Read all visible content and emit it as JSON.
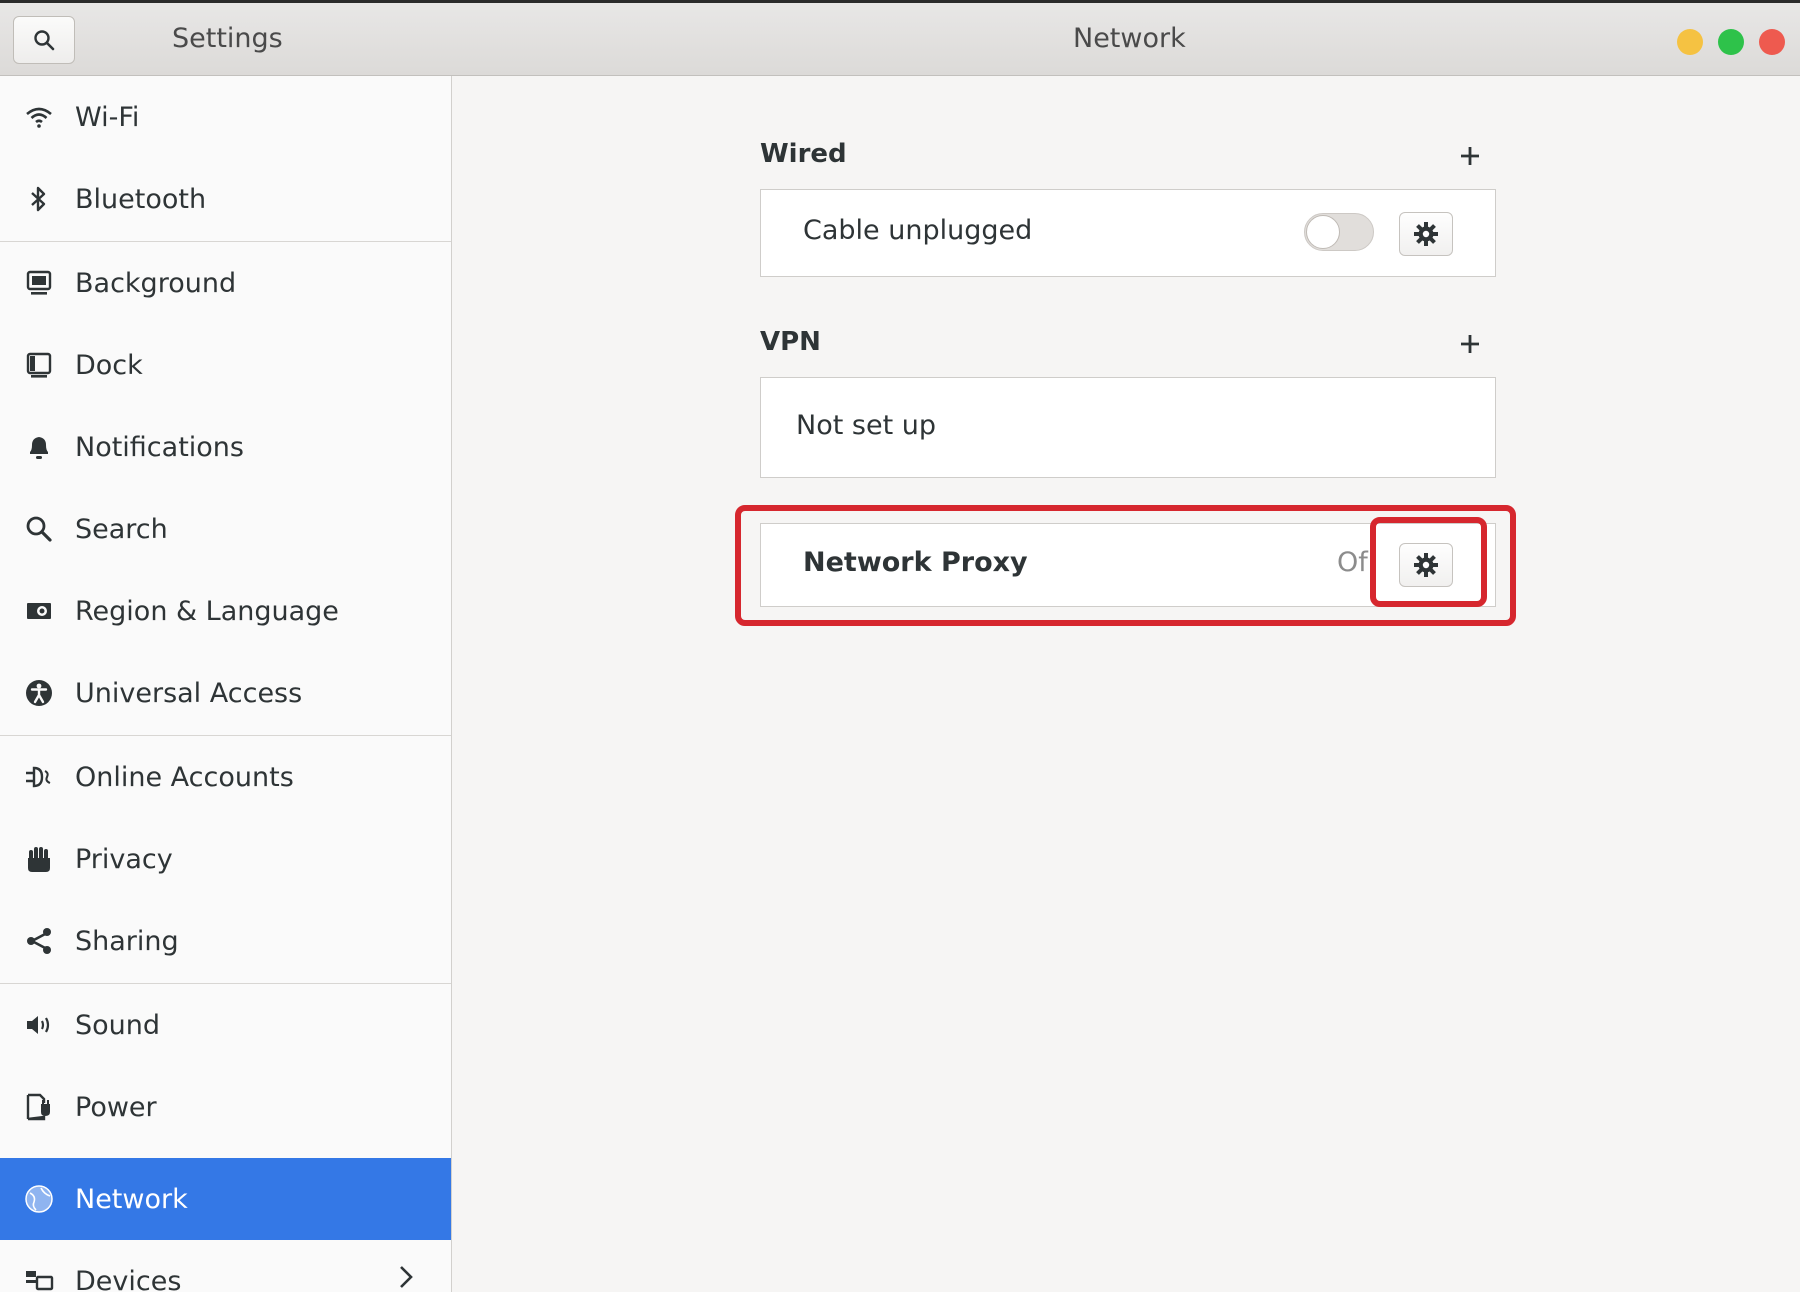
{
  "header": {
    "app_title": "Settings",
    "page_title": "Network",
    "search_icon": "search-icon",
    "window_controls": {
      "minimize_color": "#f5c242",
      "maximize_color": "#2ec24a",
      "close_color": "#ee5a4f"
    }
  },
  "sidebar": {
    "items": [
      {
        "label": "Wi-Fi",
        "icon": "wifi-icon"
      },
      {
        "label": "Bluetooth",
        "icon": "bluetooth-icon"
      },
      {
        "label": "Background",
        "icon": "background-icon"
      },
      {
        "label": "Dock",
        "icon": "dock-icon"
      },
      {
        "label": "Notifications",
        "icon": "bell-icon"
      },
      {
        "label": "Search",
        "icon": "search-icon"
      },
      {
        "label": "Region & Language",
        "icon": "region-icon"
      },
      {
        "label": "Universal Access",
        "icon": "accessibility-icon"
      },
      {
        "label": "Online Accounts",
        "icon": "online-accounts-icon"
      },
      {
        "label": "Privacy",
        "icon": "hand-icon"
      },
      {
        "label": "Sharing",
        "icon": "share-icon"
      },
      {
        "label": "Sound",
        "icon": "speaker-icon"
      },
      {
        "label": "Power",
        "icon": "power-icon"
      },
      {
        "label": "Network",
        "icon": "network-icon",
        "active": true
      },
      {
        "label": "Devices",
        "icon": "devices-icon"
      }
    ],
    "active_color": "#3478e6"
  },
  "main": {
    "wired": {
      "title": "Wired",
      "status": "Cable unplugged",
      "toggle_on": false
    },
    "vpn": {
      "title": "VPN",
      "status": "Not set up"
    },
    "proxy": {
      "label": "Network Proxy",
      "status": "Of"
    },
    "highlight_color": "#d6272e"
  }
}
